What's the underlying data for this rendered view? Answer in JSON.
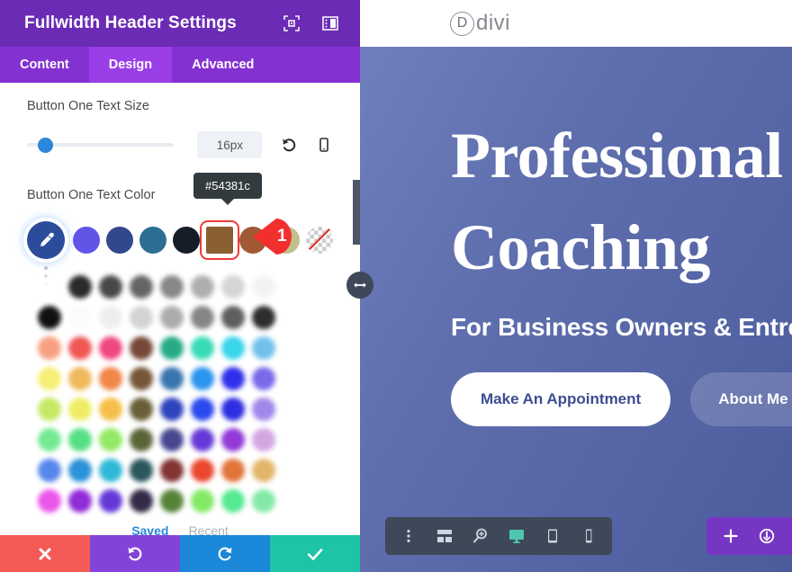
{
  "panel": {
    "title": "Fullwidth Header Settings",
    "header_icons": [
      {
        "name": "focus-frame-icon"
      },
      {
        "name": "layout-panel-icon"
      }
    ],
    "tabs": [
      {
        "label": "Content",
        "active": false
      },
      {
        "label": "Design",
        "active": true
      },
      {
        "label": "Advanced",
        "active": false
      }
    ],
    "text_size": {
      "label": "Button One Text Size",
      "value": "16px",
      "slider_percent": 12,
      "reset_icon": "undo-icon",
      "responsive_icon": "mobile-icon"
    },
    "text_color": {
      "label": "Button One Text Color",
      "tooltip": "#54381c",
      "eyedropper_icon": "eyedropper-icon",
      "swatches": [
        {
          "name": "swatch-purple",
          "color": "#6155e8",
          "selected": false
        },
        {
          "name": "swatch-navy",
          "color": "#33478d",
          "selected": false
        },
        {
          "name": "swatch-steel-blue",
          "color": "#2c6f93",
          "selected": false
        },
        {
          "name": "swatch-dark",
          "color": "#151d28",
          "selected": false
        },
        {
          "name": "swatch-brown",
          "color": "#8a6033",
          "selected": true
        },
        {
          "name": "swatch-rust",
          "color": "#a15a34",
          "selected": false
        },
        {
          "name": "swatch-khaki",
          "color": "#c0c08a",
          "selected": false
        },
        {
          "name": "swatch-transparent",
          "color": "transparent",
          "selected": false
        }
      ],
      "annotation_badge": "1",
      "palette": [
        [
          "#ffffff",
          "#1a1a1a",
          "#3b3b3b",
          "#5a5a5a",
          "#7e7e7e",
          "#a8a8a8",
          "#d2d2d2",
          "#f2f2f2"
        ],
        [
          "#000000",
          "#fbfbfb",
          "#ededed",
          "#d0d0d0",
          "#a6a6a6",
          "#7c7c7c",
          "#525252",
          "#1e1e1e"
        ],
        [
          "#f79977",
          "#ef4a4a",
          "#ef3a78",
          "#6b3b28",
          "#16a57f",
          "#2bd9b0",
          "#2ad2ea",
          "#69bdea"
        ],
        [
          "#f5ef6b",
          "#eeb44f",
          "#ef7e3b",
          "#6b4a28",
          "#2a6ba8",
          "#1b8ced",
          "#2020ea",
          "#6f5fe8"
        ],
        [
          "#c2e85a",
          "#eeec5a",
          "#f5bb3a",
          "#5d5228",
          "#1f36b8",
          "#1b3ded",
          "#1f1fe0",
          "#9a7ee8"
        ],
        [
          "#6be88a",
          "#4ade7a",
          "#8ae85a",
          "#4e5a28",
          "#3a3a8a",
          "#5a2bd4",
          "#8a2bd4",
          "#d0a0e0"
        ],
        [
          "#4a7eea",
          "#1b8ad4",
          "#20b4d4",
          "#1a4a52",
          "#7a2424",
          "#ea3a20",
          "#e06a2a",
          "#e0b060"
        ],
        [
          "#ea4aea",
          "#8a1bd4",
          "#5a2bd4",
          "#241a3a",
          "#4a7a2a",
          "#7ae85a",
          "#4ae88a",
          "#7ae8a0"
        ]
      ],
      "footer_tabs": [
        {
          "label": "Saved",
          "active": true
        },
        {
          "label": "Recent",
          "active": false
        }
      ]
    },
    "actions": [
      {
        "name": "cancel-button",
        "icon": "close-icon",
        "color": "#f45b56"
      },
      {
        "name": "undo-button",
        "icon": "undo-icon",
        "color": "#8343d9"
      },
      {
        "name": "redo-button",
        "icon": "redo-icon",
        "color": "#1a87d8"
      },
      {
        "name": "save-button",
        "icon": "check-icon",
        "color": "#1ec4a6"
      }
    ]
  },
  "preview": {
    "logo_letter": "D",
    "logo_text": "divi",
    "heading": "Professional",
    "heading2": "Coaching",
    "subheading": "For Business Owners & Entrepreneurs",
    "primary_button": "Make An Appointment",
    "secondary_button": "About Me",
    "builder_toolbar": [
      {
        "name": "more-options-icon"
      },
      {
        "name": "wireframe-icon"
      },
      {
        "name": "zoom-icon"
      },
      {
        "name": "desktop-icon",
        "active": true
      },
      {
        "name": "tablet-icon"
      },
      {
        "name": "phone-icon"
      }
    ],
    "builder_actions": [
      {
        "name": "add-icon"
      },
      {
        "name": "power-icon"
      },
      {
        "name": "trash-icon"
      }
    ],
    "splitter_icon": "horizontal-resize-icon"
  }
}
